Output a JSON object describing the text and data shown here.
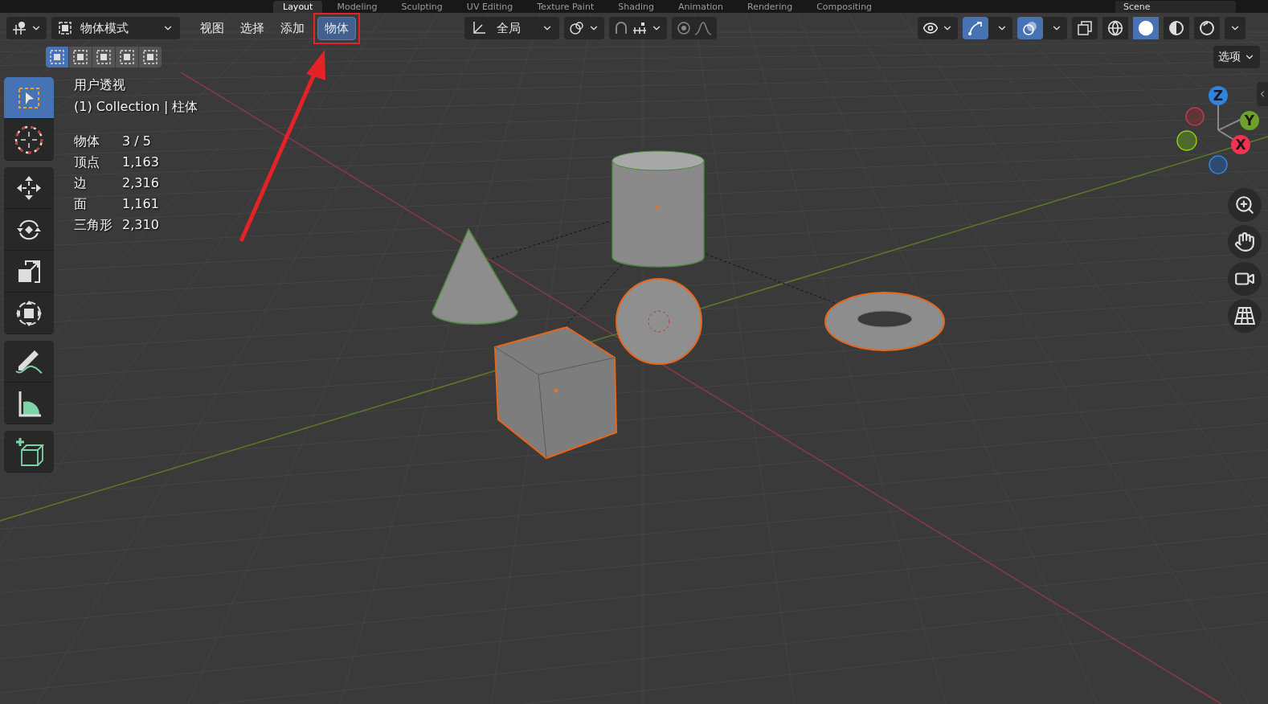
{
  "workspace_tabs": [
    {
      "label": "Layout",
      "selected": true
    },
    {
      "label": "Modeling",
      "selected": false
    },
    {
      "label": "Sculpting",
      "selected": false
    },
    {
      "label": "UV Editing",
      "selected": false
    },
    {
      "label": "Texture Paint",
      "selected": false
    },
    {
      "label": "Shading",
      "selected": false
    },
    {
      "label": "Animation",
      "selected": false
    },
    {
      "label": "Rendering",
      "selected": false
    },
    {
      "label": "Compositing",
      "selected": false
    }
  ],
  "scene_field": {
    "value": "Scene"
  },
  "header": {
    "mode_dropdown": "物体模式",
    "menus": [
      {
        "label": "视图",
        "selected": false
      },
      {
        "label": "选择",
        "selected": false
      },
      {
        "label": "添加",
        "selected": false
      },
      {
        "label": "物体",
        "selected": true,
        "highlighted": true
      }
    ],
    "orientation_dropdown": "全局",
    "select_modes": [
      {
        "selected": true
      },
      {
        "selected": false
      },
      {
        "selected": false
      },
      {
        "selected": false
      },
      {
        "selected": false
      }
    ],
    "gizmo_toggle": {
      "on": true
    },
    "overlay_toggle": {
      "on": true
    },
    "shading_modes": [
      {
        "kind": "wireframe",
        "selected": false
      },
      {
        "kind": "solid",
        "selected": true
      },
      {
        "kind": "material",
        "selected": false
      },
      {
        "kind": "rendered",
        "selected": false
      }
    ],
    "options_button": "选项"
  },
  "stats": {
    "view_name": "用户透视",
    "collection": "(1) Collection | 柱体",
    "rows": [
      {
        "label": "物体",
        "value": "3 / 5"
      },
      {
        "label": "顶点",
        "value": "1,163"
      },
      {
        "label": "边",
        "value": "2,316"
      },
      {
        "label": "面",
        "value": "1,161"
      },
      {
        "label": "三角形",
        "value": "2,310"
      }
    ]
  },
  "tool_groups": [
    {
      "tools": [
        {
          "kind": "select",
          "selected": true
        },
        {
          "kind": "cursor",
          "selected": false
        }
      ]
    },
    {
      "tools": [
        {
          "kind": "move",
          "selected": false
        },
        {
          "kind": "rotate",
          "selected": false
        },
        {
          "kind": "scale",
          "selected": false
        },
        {
          "kind": "transform",
          "selected": false
        }
      ]
    },
    {
      "tools": [
        {
          "kind": "annotate",
          "selected": false
        },
        {
          "kind": "measure",
          "selected": false
        }
      ]
    },
    {
      "tools": [
        {
          "kind": "add_cube",
          "selected": false
        }
      ]
    }
  ],
  "axis_gizmo": [
    {
      "label": "Z",
      "color": "#2f83e3"
    },
    {
      "label": "Y",
      "color": "#6fa12a"
    },
    {
      "label": "X",
      "color": "#f0344f"
    }
  ],
  "nav_buttons": [
    {
      "kind": "zoom"
    },
    {
      "kind": "pan"
    },
    {
      "kind": "camera"
    },
    {
      "kind": "ortho"
    }
  ]
}
